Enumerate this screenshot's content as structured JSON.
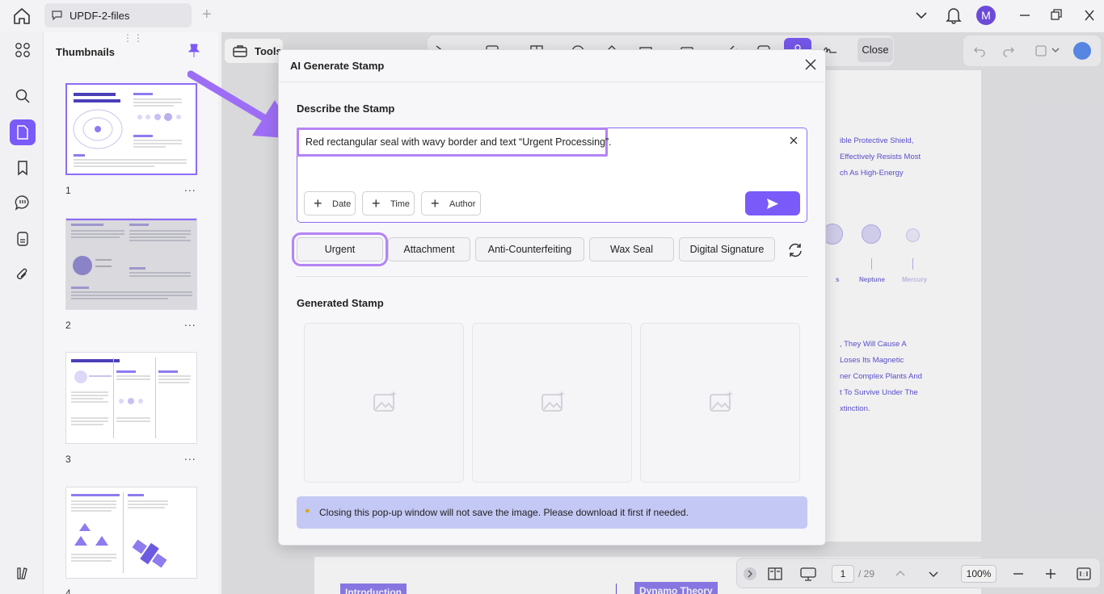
{
  "window": {
    "tab_title": "UPDF-2-files",
    "avatar_initial": "M"
  },
  "sidebar": {
    "panel_title": "Thumbnails",
    "pages": [
      {
        "number": "1",
        "selected": true
      },
      {
        "number": "2",
        "selected": false
      },
      {
        "number": "3",
        "selected": false
      },
      {
        "number": "4",
        "selected": false
      }
    ],
    "more": "..."
  },
  "toolbar": {
    "tools_label": "Tools",
    "close_label": "Close"
  },
  "document": {
    "lines_top": [
      "ible Protective Shield,",
      "Effectively Resists Most",
      "ch As High-Energy"
    ],
    "planet_labels": [
      "s",
      "Neptune",
      "Mercury"
    ],
    "lines_mid": [
      ", They Will Cause A",
      "Loses Its Magnetic",
      "ner Complex Plants And",
      "t To Survive Under The",
      "xtinction."
    ],
    "page2_tags": [
      "Introduction",
      "Dynamo Theory"
    ]
  },
  "pagination": {
    "current_page": "1",
    "total": "/ 29",
    "zoom": "100%"
  },
  "dialog": {
    "title": "AI Generate Stamp",
    "describe_label": "Describe the Stamp",
    "prompt_value": "Red rectangular seal with wavy border and text “Urgent Processing”.",
    "chips": [
      "Date",
      "Time",
      "Author"
    ],
    "presets": [
      "Urgent",
      "Attachment",
      "Anti-Counterfeiting",
      "Wax Seal",
      "Digital Signature"
    ],
    "generated_label": "Generated Stamp",
    "notice": "Closing this pop-up window will not save the image. Please download it first if needed."
  },
  "colors": {
    "accent": "#7a5af8",
    "highlight": "#b583f5",
    "notice_bg": "#c3c8f4"
  }
}
